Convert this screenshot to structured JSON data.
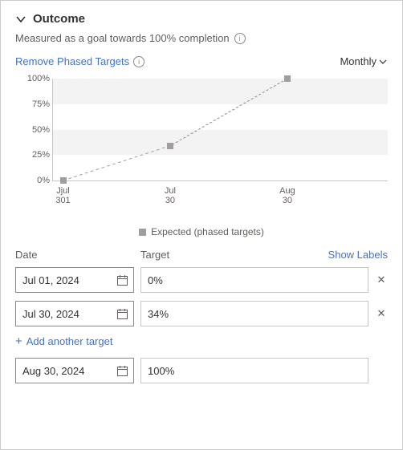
{
  "header": {
    "title": "Outcome",
    "subtitle": "Measured as a goal towards 100% completion"
  },
  "controls": {
    "remove_phased_label": "Remove Phased Targets",
    "frequency": "Monthly"
  },
  "chart_data": {
    "type": "line",
    "title": "",
    "xlabel": "",
    "ylabel": "",
    "ylim": [
      0,
      100
    ],
    "y_ticks": [
      "0%",
      "25%",
      "50%",
      "75%",
      "100%"
    ],
    "categories": [
      "Jul 01",
      "Jul 30",
      "Aug 30"
    ],
    "x_labels": [
      {
        "line1": "Jjul",
        "line2": "301"
      },
      {
        "line1": "Jul",
        "line2": "30"
      },
      {
        "line1": "Aug",
        "line2": "30"
      }
    ],
    "series": [
      {
        "name": "Expected (phased targets)",
        "values": [
          0,
          34,
          100
        ]
      }
    ],
    "legend": "Expected (phased targets)"
  },
  "columns": {
    "date": "Date",
    "target": "Target",
    "show_labels": "Show Labels"
  },
  "targets": [
    {
      "date": "Jul 01, 2024",
      "value": "0%",
      "removable": true
    },
    {
      "date": "Jul 30, 2024",
      "value": "34%",
      "removable": true
    },
    {
      "date": "Aug 30, 2024",
      "value": "100%",
      "removable": false
    }
  ],
  "add_another": "Add another target"
}
